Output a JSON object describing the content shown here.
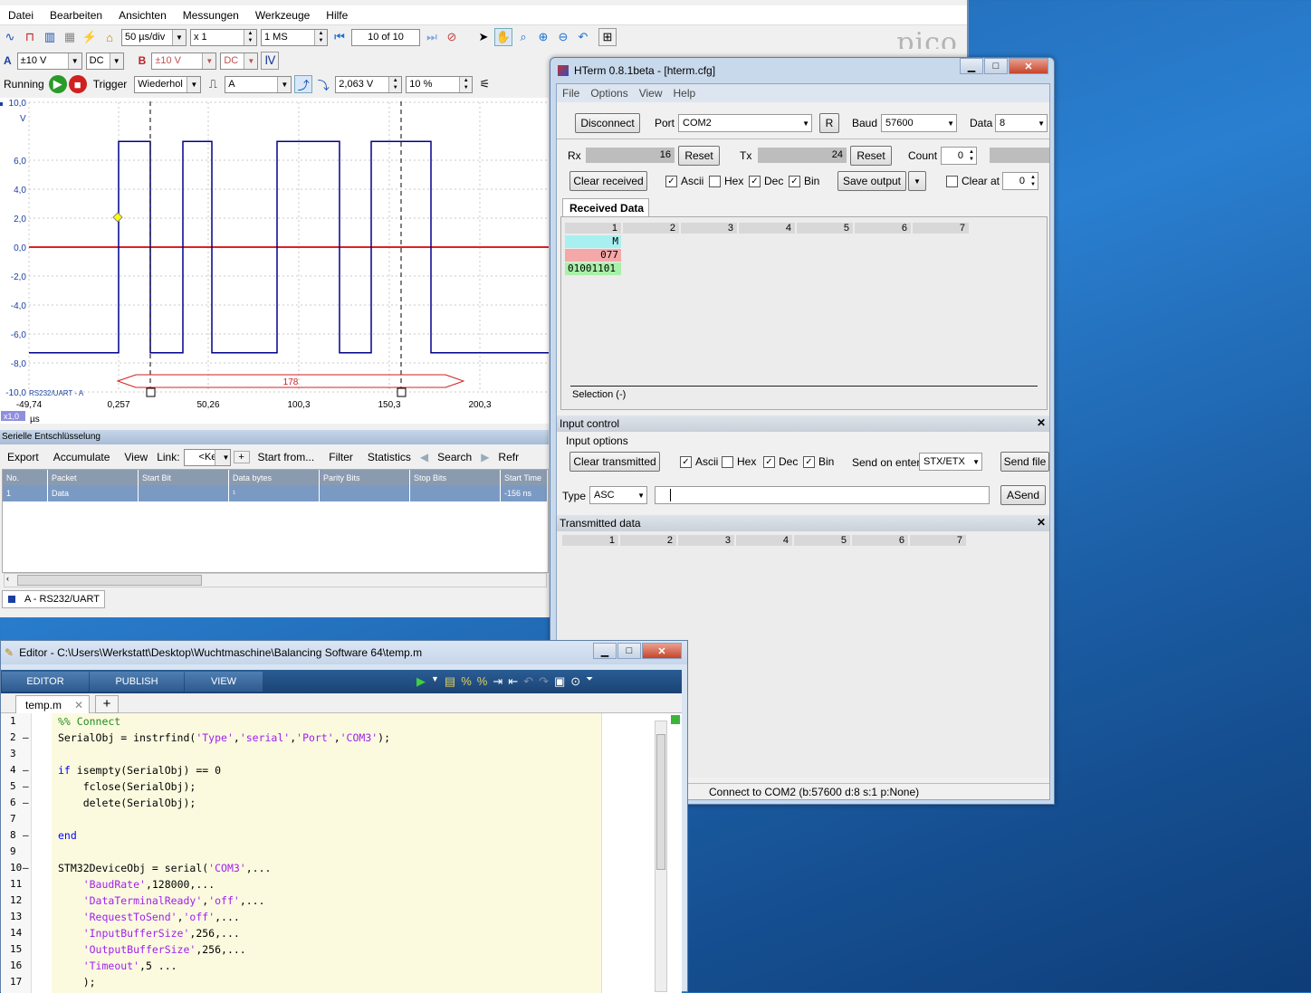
{
  "pico": {
    "menu": [
      "Datei",
      "Bearbeiten",
      "Ansichten",
      "Messungen",
      "Werkzeuge",
      "Hilfe"
    ],
    "timebase": "50 µs/div",
    "zoom": "x 1",
    "samples": "1 MS",
    "capture_of": "10 of 10",
    "logo": "pico",
    "chA": {
      "label": "A",
      "range": "±10 V",
      "coupling": "DC"
    },
    "chB": {
      "label": "B",
      "range": "±10 V",
      "coupling": "DC"
    },
    "run_state": "Running",
    "trigger_label": "Trigger",
    "trigger_mode": "Wiederhol",
    "trigger_source": "A",
    "trigger_level": "2,063 V",
    "pretrigger": "10 %",
    "scope": {
      "y_ticks": [
        "10,0",
        "6,0",
        "4,0",
        "2,0",
        "0,0",
        "-2,0",
        "-4,0",
        "-6,0",
        "-8,0",
        "-10,0"
      ],
      "y_unit": "V",
      "x_ticks": [
        "-49,74",
        "0,257",
        "50,26",
        "100,3",
        "150,3",
        "200,3"
      ],
      "x_unit": "µs",
      "x_zoom": "x1,0",
      "ruler_value": "178",
      "decoder_label": "RS232/UART - A"
    },
    "decode": {
      "title": "Serielle Entschlüsselung",
      "toolbar": [
        "Export",
        "Accumulate",
        "View",
        "Link:",
        "Start from...",
        "Filter",
        "Statistics",
        "Search",
        "Refr"
      ],
      "link_value": "<Keine",
      "columns": [
        "No.",
        "Packet",
        "Start Bit",
        "Data bytes",
        "Parity Bits",
        "Stop Bits",
        "Start Time"
      ],
      "rows": [
        [
          "1",
          "Data",
          "",
          "¹",
          "",
          "",
          "-156 ns"
        ]
      ],
      "tab": "A - RS232/UART"
    }
  },
  "hterm": {
    "title": "HTerm 0.8.1beta - [hterm.cfg]",
    "menu": [
      "File",
      "Options",
      "View",
      "Help"
    ],
    "disconnect": "Disconnect",
    "port_label": "Port",
    "port": "COM2",
    "r_button": "R",
    "baud_label": "Baud",
    "baud": "57600",
    "data_label": "Data",
    "data": "8",
    "rx_label": "Rx",
    "rx": "16",
    "tx_label": "Tx",
    "tx": "24",
    "reset": "Reset",
    "count_label": "Count",
    "count": "0",
    "clear_received": "Clear received",
    "ascii": "Ascii",
    "hex": "Hex",
    "dec": "Dec",
    "bin": "Bin",
    "save_output": "Save output",
    "clear_at": "Clear at",
    "clear_at_value": "0",
    "received_tab": "Received Data",
    "columns": [
      "1",
      "2",
      "3",
      "4",
      "5",
      "6",
      "7"
    ],
    "rx_ascii": "M",
    "rx_dec": "077",
    "rx_bin": "01001101",
    "selection": "Selection (-)",
    "input_control": "Input control",
    "input_options": "Input options",
    "clear_transmitted": "Clear transmitted",
    "send_on_enter_label": "Send on enter",
    "send_on_enter": "STX/ETX",
    "send_file": "Send file",
    "type_label": "Type",
    "type": "ASC",
    "asend": "ASend",
    "transmitted": "Transmitted data",
    "status": "Connect to COM2 (b:57600 d:8 s:1 p:None)"
  },
  "editor": {
    "title": "Editor - C:\\Users\\Werkstatt\\Desktop\\Wuchtmaschine\\Balancing Software 64\\temp.m",
    "tabs": [
      "EDITOR",
      "PUBLISH",
      "VIEW"
    ],
    "file_tab": "temp.m",
    "lines": [
      {
        "n": "1",
        "d": "",
        "segs": [
          [
            "cm",
            "%% Connect"
          ]
        ]
      },
      {
        "n": "2",
        "d": "–",
        "segs": [
          [
            "",
            "SerialObj = instrfind("
          ],
          [
            "str",
            "'Type'"
          ],
          [
            "",
            ","
          ],
          [
            "str",
            "'serial'"
          ],
          [
            "",
            ","
          ],
          [
            "str",
            "'Port'"
          ],
          [
            "",
            ","
          ],
          [
            "str",
            "'COM3'"
          ],
          [
            "",
            ");"
          ]
        ]
      },
      {
        "n": "3",
        "d": "",
        "segs": []
      },
      {
        "n": "4",
        "d": "–",
        "segs": [
          [
            "kw",
            "if"
          ],
          [
            "",
            " isempty(SerialObj) == 0"
          ]
        ]
      },
      {
        "n": "5",
        "d": "–",
        "segs": [
          [
            "",
            "    fclose(SerialObj);"
          ]
        ]
      },
      {
        "n": "6",
        "d": "–",
        "segs": [
          [
            "",
            "    delete(SerialObj);"
          ]
        ]
      },
      {
        "n": "7",
        "d": "",
        "segs": []
      },
      {
        "n": "8",
        "d": "–",
        "segs": [
          [
            "kw",
            "end"
          ]
        ]
      },
      {
        "n": "9",
        "d": "",
        "segs": []
      },
      {
        "n": "10",
        "d": "–",
        "segs": [
          [
            "",
            "STM32DeviceObj = serial("
          ],
          [
            "str",
            "'COM3'"
          ],
          [
            "",
            ",..."
          ]
        ]
      },
      {
        "n": "11",
        "d": "",
        "segs": [
          [
            "",
            "    "
          ],
          [
            "str",
            "'BaudRate'"
          ],
          [
            "",
            ",128000,..."
          ]
        ]
      },
      {
        "n": "12",
        "d": "",
        "segs": [
          [
            "",
            "    "
          ],
          [
            "str",
            "'DataTerminalReady'"
          ],
          [
            "",
            ","
          ],
          [
            "str",
            "'off'"
          ],
          [
            "",
            ",..."
          ]
        ]
      },
      {
        "n": "13",
        "d": "",
        "segs": [
          [
            "",
            "    "
          ],
          [
            "str",
            "'RequestToSend'"
          ],
          [
            "",
            ","
          ],
          [
            "str",
            "'off'"
          ],
          [
            "",
            ",..."
          ]
        ]
      },
      {
        "n": "14",
        "d": "",
        "segs": [
          [
            "",
            "    "
          ],
          [
            "str",
            "'InputBufferSize'"
          ],
          [
            "",
            ",256,..."
          ]
        ]
      },
      {
        "n": "15",
        "d": "",
        "segs": [
          [
            "",
            "    "
          ],
          [
            "str",
            "'OutputBufferSize'"
          ],
          [
            "",
            ",256,..."
          ]
        ]
      },
      {
        "n": "16",
        "d": "",
        "segs": [
          [
            "",
            "    "
          ],
          [
            "str",
            "'Timeout'"
          ],
          [
            "",
            ",5 ..."
          ]
        ]
      },
      {
        "n": "17",
        "d": "",
        "segs": [
          [
            "",
            "    );"
          ]
        ]
      }
    ]
  },
  "colors": {
    "channel_a": "#00008b",
    "channel_b": "#dd2222",
    "rx_ascii_bg": "#a8f0f0",
    "rx_dec_bg": "#f5a8a8",
    "rx_bin_bg": "#a8f0a8"
  }
}
